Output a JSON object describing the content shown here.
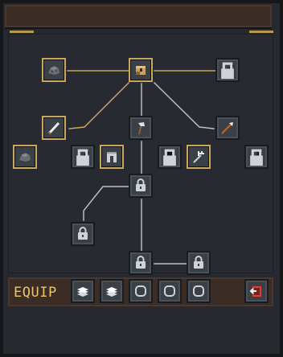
{
  "equip_bar": {
    "label": "EQUIP"
  },
  "colors": {
    "panel": "#262a30",
    "header": "#3b2c25",
    "gold": "#c9a85c",
    "link_active": "#c9a85c",
    "link_inactive": "#b9bec4",
    "label": "#e9c46a",
    "exit_red": "#d24242"
  },
  "tree": {
    "nodes": [
      {
        "id": "n1",
        "icon": "coal-lump-icon",
        "state": "owned"
      },
      {
        "id": "n2",
        "icon": "treasure-chest-icon",
        "state": "owned"
      },
      {
        "id": "n3",
        "icon": "staff-icon",
        "state": "locked"
      },
      {
        "id": "n4",
        "icon": "sword-icon",
        "state": "owned"
      },
      {
        "id": "n5",
        "icon": "axe-icon",
        "state": "available"
      },
      {
        "id": "n6",
        "icon": "spear-icon",
        "state": "available"
      },
      {
        "id": "n7",
        "icon": "coal-lump-icon",
        "state": "owned"
      },
      {
        "id": "n8",
        "icon": "staff-icon",
        "state": "locked"
      },
      {
        "id": "n9",
        "icon": "iron-leggings-icon",
        "state": "owned"
      },
      {
        "id": "n10",
        "icon": "chestplate-icon",
        "state": "locked"
      },
      {
        "id": "n11",
        "icon": "trident-icon",
        "state": "owned"
      },
      {
        "id": "n12",
        "icon": "crossbow-icon",
        "state": "locked"
      },
      {
        "id": "n13",
        "icon": "padlock-icon",
        "state": "locked"
      },
      {
        "id": "n14",
        "icon": "padlock-icon",
        "state": "locked"
      },
      {
        "id": "n15",
        "icon": "padlock-icon",
        "state": "locked"
      },
      {
        "id": "n16",
        "icon": "padlock-icon",
        "state": "locked"
      }
    ]
  },
  "equip_slots": [
    {
      "icon": "cloth-stack-icon"
    },
    {
      "icon": "cloth-stack-icon"
    },
    {
      "icon": "empty-slot-ring-icon"
    },
    {
      "icon": "empty-slot-ring-icon"
    },
    {
      "icon": "empty-slot-ring-icon"
    }
  ],
  "exit_button": {
    "icon": "exit-door-icon"
  }
}
